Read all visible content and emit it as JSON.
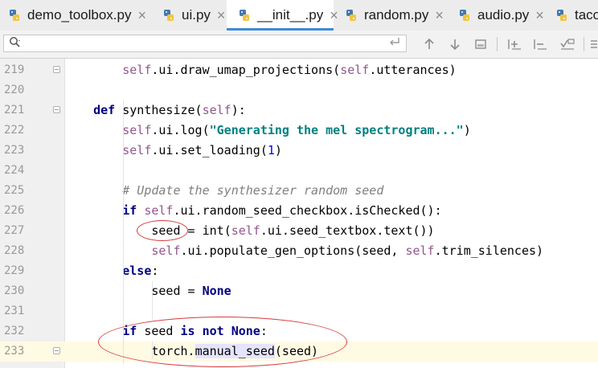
{
  "tabs": [
    {
      "label": "demo_toolbox.py",
      "active": false,
      "close": "×"
    },
    {
      "label": "ui.py",
      "active": false,
      "close": "×"
    },
    {
      "label": "__init__.py",
      "active": true,
      "close": "×"
    },
    {
      "label": "random.py",
      "active": false,
      "close": "×"
    },
    {
      "label": "audio.py",
      "active": false,
      "close": "×"
    },
    {
      "label": "tacot",
      "active": false,
      "close": ""
    }
  ],
  "search": {
    "value": "",
    "placeholder": ""
  },
  "toolbar_icons": [
    "search-icon",
    "enter-icon",
    "arrow-up-icon",
    "arrow-down-icon",
    "select-all-icon",
    "add-selection-icon",
    "remove-selection-icon",
    "match-occurrences-icon",
    "settings-icon"
  ],
  "colors": {
    "keyword": "#000080",
    "self": "#94558d",
    "string": "#008080",
    "number": "#0000ff",
    "comment": "#808080",
    "annotation": "#d93a3a",
    "tab_active_underline": "#3d8bd6"
  },
  "lines": [
    {
      "number": "219",
      "indent": "        ",
      "tokens": [
        {
          "t": "self",
          "c": "self"
        },
        {
          "t": ".ui.draw_umap_projections(",
          "c": ""
        },
        {
          "t": "self",
          "c": "self"
        },
        {
          "t": ".utterances)",
          "c": ""
        }
      ]
    },
    {
      "number": "220",
      "indent": "",
      "tokens": []
    },
    {
      "number": "221",
      "indent": "    ",
      "tokens": [
        {
          "t": "def",
          "c": "kw"
        },
        {
          "t": " synthesize(",
          "c": ""
        },
        {
          "t": "self",
          "c": "self"
        },
        {
          "t": "):",
          "c": ""
        }
      ]
    },
    {
      "number": "222",
      "indent": "        ",
      "tokens": [
        {
          "t": "self",
          "c": "self"
        },
        {
          "t": ".ui.log(",
          "c": ""
        },
        {
          "t": "\"Generating the mel spectrogram...\"",
          "c": "str"
        },
        {
          "t": ")",
          "c": ""
        }
      ]
    },
    {
      "number": "223",
      "indent": "        ",
      "tokens": [
        {
          "t": "self",
          "c": "self"
        },
        {
          "t": ".ui.set_loading(",
          "c": ""
        },
        {
          "t": "1",
          "c": "num"
        },
        {
          "t": ")",
          "c": ""
        }
      ]
    },
    {
      "number": "224",
      "indent": "",
      "tokens": []
    },
    {
      "number": "225",
      "indent": "        ",
      "tokens": [
        {
          "t": "# Update the synthesizer random seed",
          "c": "cmt"
        }
      ]
    },
    {
      "number": "226",
      "indent": "        ",
      "tokens": [
        {
          "t": "if",
          "c": "kw"
        },
        {
          "t": " ",
          "c": ""
        },
        {
          "t": "self",
          "c": "self"
        },
        {
          "t": ".ui.random_seed_checkbox.isChecked():",
          "c": ""
        }
      ]
    },
    {
      "number": "227",
      "indent": "            ",
      "tokens": [
        {
          "t": "seed = ",
          "c": ""
        },
        {
          "t": "int",
          "c": ""
        },
        {
          "t": "(",
          "c": ""
        },
        {
          "t": "self",
          "c": "self"
        },
        {
          "t": ".ui.seed_textbox.text())",
          "c": ""
        }
      ]
    },
    {
      "number": "228",
      "indent": "            ",
      "tokens": [
        {
          "t": "self",
          "c": "self"
        },
        {
          "t": ".ui.populate_gen_options(seed, ",
          "c": ""
        },
        {
          "t": "self",
          "c": "self"
        },
        {
          "t": ".trim_silences)",
          "c": ""
        }
      ]
    },
    {
      "number": "229",
      "indent": "        ",
      "tokens": [
        {
          "t": "else",
          "c": "kw"
        },
        {
          "t": ":",
          "c": ""
        }
      ]
    },
    {
      "number": "230",
      "indent": "            ",
      "tokens": [
        {
          "t": "seed = ",
          "c": ""
        },
        {
          "t": "None",
          "c": "kw"
        }
      ]
    },
    {
      "number": "231",
      "indent": "",
      "tokens": []
    },
    {
      "number": "232",
      "indent": "        ",
      "tokens": [
        {
          "t": "if",
          "c": "kw"
        },
        {
          "t": " seed ",
          "c": ""
        },
        {
          "t": "is not None",
          "c": "kw"
        },
        {
          "t": ":",
          "c": ""
        }
      ]
    },
    {
      "number": "233",
      "indent": "            ",
      "tokens": [
        {
          "t": "torch.",
          "c": ""
        },
        {
          "t": "manual_seed",
          "c": "hl"
        },
        {
          "t": "(seed)",
          "c": ""
        }
      ],
      "current": true
    }
  ]
}
